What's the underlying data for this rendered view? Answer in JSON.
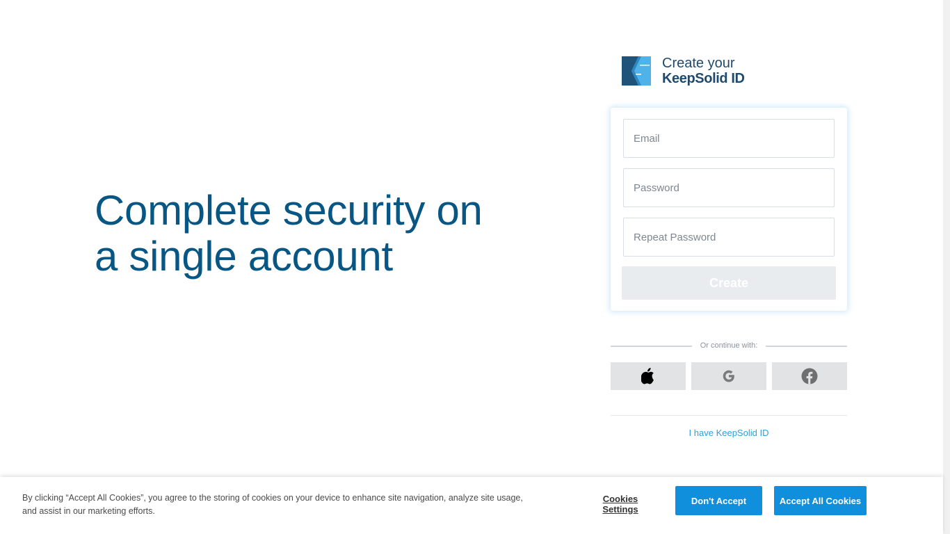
{
  "hero": {
    "line1": "Complete security on",
    "line2": "a single account"
  },
  "brand": {
    "logo_icon": "keepsolid-logo-icon",
    "line1": "Create your",
    "line2": "KeepSolid ID"
  },
  "form": {
    "email_placeholder": "Email",
    "email_value": "",
    "password_placeholder": "Password",
    "password_value": "",
    "repeat_placeholder": "Repeat Password",
    "repeat_value": "",
    "create_label": "Create"
  },
  "social": {
    "divider_text": "Or continue with:",
    "providers": [
      {
        "name": "apple",
        "icon": "apple-icon"
      },
      {
        "name": "google",
        "icon": "google-icon"
      },
      {
        "name": "facebook",
        "icon": "facebook-icon"
      }
    ]
  },
  "login_link": "I have KeepSolid ID",
  "cookies": {
    "text": "By clicking “Accept All Cookies”, you agree to the storing of cookies on your device to enhance site navigation, analyze site usage, and assist in our marketing efforts.",
    "settings_label": "Cookies Settings",
    "reject_label": "Don't Accept",
    "accept_label": "Accept All Cookies"
  },
  "colors": {
    "heading": "#075683",
    "brand_text": "#1e4a6e",
    "link": "#2d9fdb",
    "cookie_button": "#0f8fdc",
    "create_disabled_bg": "#e8ecef",
    "social_bg": "#e1e3e5"
  }
}
